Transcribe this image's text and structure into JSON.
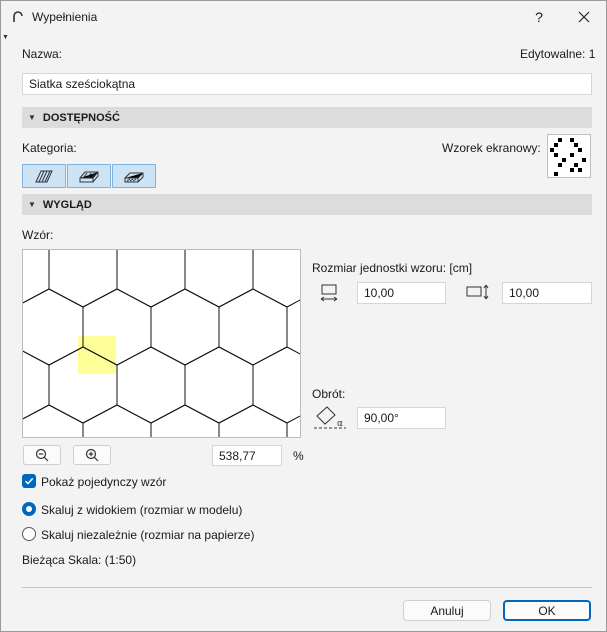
{
  "window": {
    "title": "Wypełnienia"
  },
  "name": {
    "label": "Nazwa:",
    "value": "Siatka sześciokątna",
    "editable_label": "Edytowalne: 1"
  },
  "sections": {
    "availability": "DOSTĘPNOŚĆ",
    "appearance": "WYGLĄD"
  },
  "category": {
    "label": "Kategoria:",
    "buttons": [
      "drafting-fill-icon",
      "cut-fill-icon",
      "cover-fill-icon"
    ]
  },
  "screen_pattern": {
    "label": "Wzorek ekranowy:"
  },
  "pattern": {
    "label": "Wzór:",
    "highlight_color": "#ffff99"
  },
  "unit_size": {
    "label": "Rozmiar jednostki wzoru: [cm]",
    "width": "10,00",
    "height": "10,00"
  },
  "rotation": {
    "label": "Obrót:",
    "value": "90,00°"
  },
  "zoom": {
    "value": "538,77",
    "unit": "%"
  },
  "options": {
    "single_pattern": "Pokaż pojedynczy wzór",
    "scale_with_view": "Skaluj z widokiem (rozmiar w modelu)",
    "scale_independent": "Skaluj niezależnie (rozmiar na papierze)",
    "current_scale": "Bieżąca Skala: (1:50)"
  },
  "buttons": {
    "cancel": "Anuluj",
    "ok": "OK"
  },
  "colors": {
    "accent": "#0067c0",
    "section_bg": "#dcdcdc"
  }
}
